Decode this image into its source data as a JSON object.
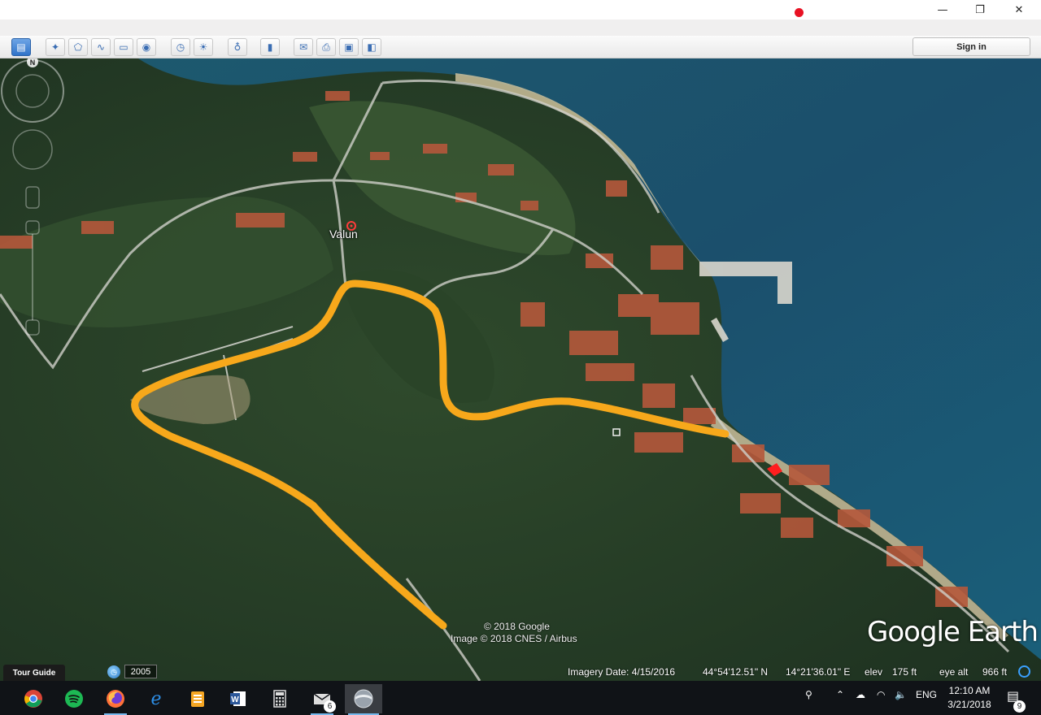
{
  "toolbar": {
    "sign_in_label": "Sign in",
    "buttons": [
      {
        "name": "sidebar-toggle-icon",
        "glyph": "▤"
      },
      {
        "name": "add-placemark-icon",
        "glyph": "✦"
      },
      {
        "name": "add-polygon-icon",
        "glyph": "⬠"
      },
      {
        "name": "add-path-icon",
        "glyph": "∿"
      },
      {
        "name": "add-image-overlay-icon",
        "glyph": "▭"
      },
      {
        "name": "record-tour-icon",
        "glyph": "◉"
      },
      {
        "name": "historical-imagery-icon",
        "glyph": "◷"
      },
      {
        "name": "sunlight-icon",
        "glyph": "☀"
      },
      {
        "name": "switch-planet-icon",
        "glyph": "♁"
      },
      {
        "name": "ruler-icon",
        "glyph": "▮"
      },
      {
        "name": "email-icon",
        "glyph": "✉"
      },
      {
        "name": "print-icon",
        "glyph": "⎙"
      },
      {
        "name": "save-image-icon",
        "glyph": "▣"
      },
      {
        "name": "view-in-maps-icon",
        "glyph": "◧"
      }
    ]
  },
  "map": {
    "place_label": "Valun",
    "copyright_google": "© 2018 Google",
    "copyright_image": "Image © 2018 CNES / Airbus",
    "logo_text": "Google Earth",
    "compass_north": "N",
    "route_color": "#f7a81b"
  },
  "status": {
    "tour_guide": "Tour Guide",
    "history_year": "2005",
    "imagery_date": "Imagery Date: 4/15/2016",
    "latitude": "44°54'12.51\" N",
    "longitude": "14°21'36.01\" E",
    "elev_label": "elev",
    "elev_value": "175 ft",
    "eye_alt_label": "eye alt",
    "eye_alt_value": "966 ft"
  },
  "taskbar": {
    "language": "ENG",
    "time": "12:10 AM",
    "date": "3/21/2018",
    "notification_count": "9",
    "mail_badge": "6",
    "apps": [
      {
        "name": "chrome-icon"
      },
      {
        "name": "spotify-icon"
      },
      {
        "name": "firefox-icon"
      },
      {
        "name": "edge-icon"
      },
      {
        "name": "archive-icon"
      },
      {
        "name": "word-icon"
      },
      {
        "name": "calculator-icon"
      },
      {
        "name": "mail-icon"
      },
      {
        "name": "google-earth-icon"
      }
    ]
  }
}
